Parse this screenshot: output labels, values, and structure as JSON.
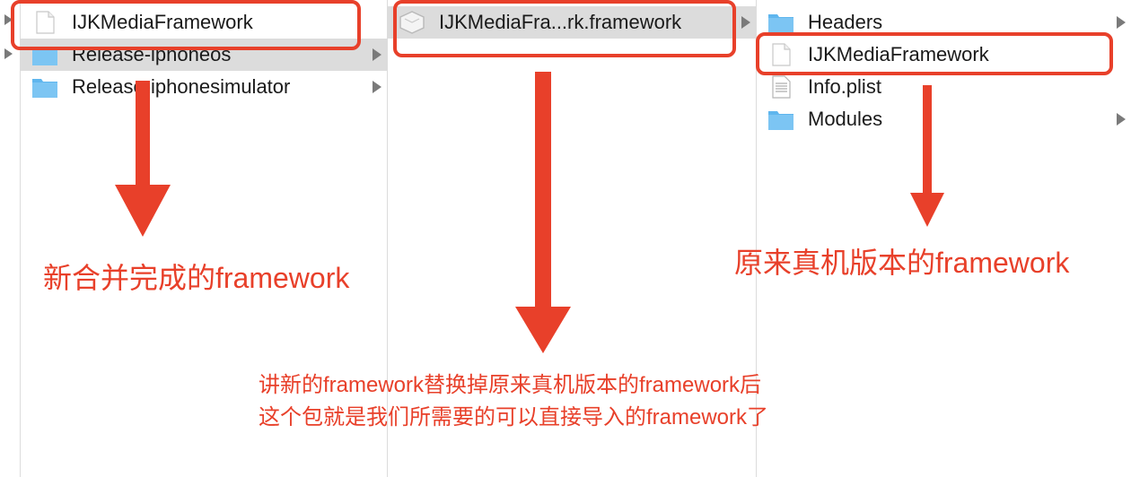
{
  "browser": {
    "column1": {
      "items": [
        {
          "label": "IJKMediaFramework",
          "icon": "file-icon",
          "selected": false,
          "has_children": false
        },
        {
          "label": "Release-iphoneos",
          "icon": "folder-icon",
          "selected": true,
          "has_children": true
        },
        {
          "label": "Release-iphonesimulator",
          "icon": "folder-icon",
          "selected": false,
          "has_children": true
        }
      ]
    },
    "column2": {
      "items": [
        {
          "label": "IJKMediaFra...rk.framework",
          "icon": "framework-icon",
          "selected": true,
          "has_children": true
        }
      ]
    },
    "column3": {
      "items": [
        {
          "label": "Headers",
          "icon": "folder-icon",
          "has_children": true
        },
        {
          "label": "IJKMediaFramework",
          "icon": "file-icon",
          "has_children": false
        },
        {
          "label": "Info.plist",
          "icon": "plist-icon",
          "has_children": false
        },
        {
          "label": "Modules",
          "icon": "folder-icon",
          "has_children": true
        }
      ]
    }
  },
  "annotations": {
    "left": "新合并完成的framework",
    "right": "原来真机版本的framework",
    "center_line1": "讲新的framework替换掉原来真机版本的framework后",
    "center_line2": "这个包就是我们所需要的可以直接导入的framework了"
  },
  "colors": {
    "annotation": "#e8402a",
    "selection": "#dcdcdc",
    "folder": "#5fb6ee"
  }
}
